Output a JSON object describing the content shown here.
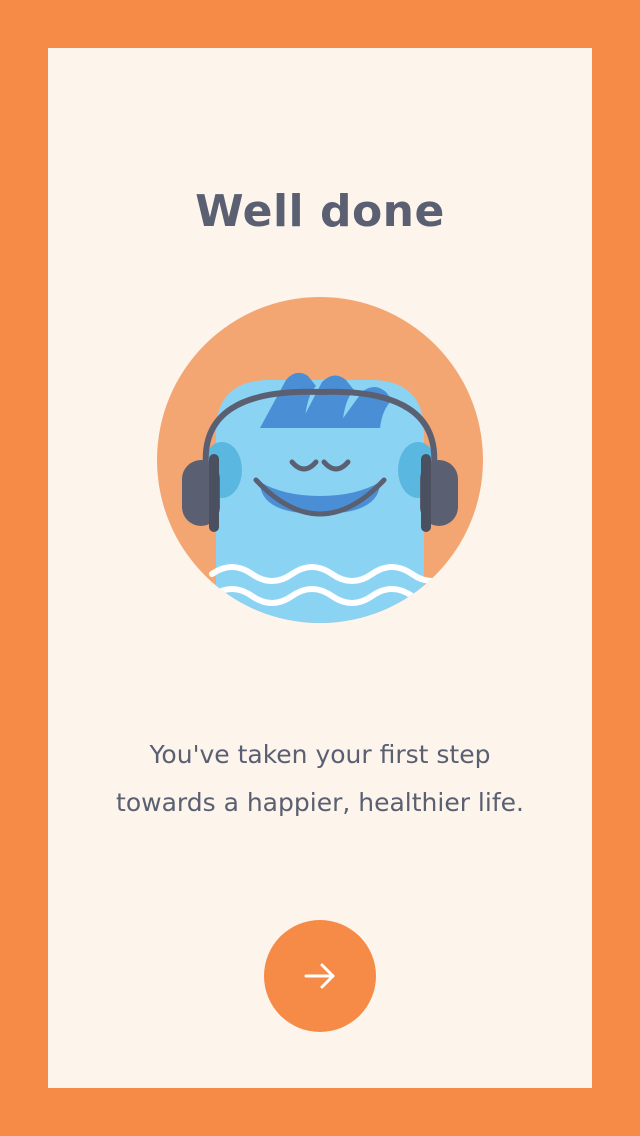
{
  "screen": {
    "title": "Well done",
    "message_line_1": "You've taken your first step",
    "message_line_2": "towards a happier, healthier life."
  },
  "icons": {
    "illustration": "meditating-character-with-headphones",
    "next": "arrow-right-icon"
  },
  "colors": {
    "frame": "#F58B46",
    "card": "#FDF4EC",
    "text": "#5A6072",
    "button": "#F58B46",
    "character": "#8BD3F2",
    "hair": "#4A8FD6",
    "badge": "#F4A672"
  }
}
